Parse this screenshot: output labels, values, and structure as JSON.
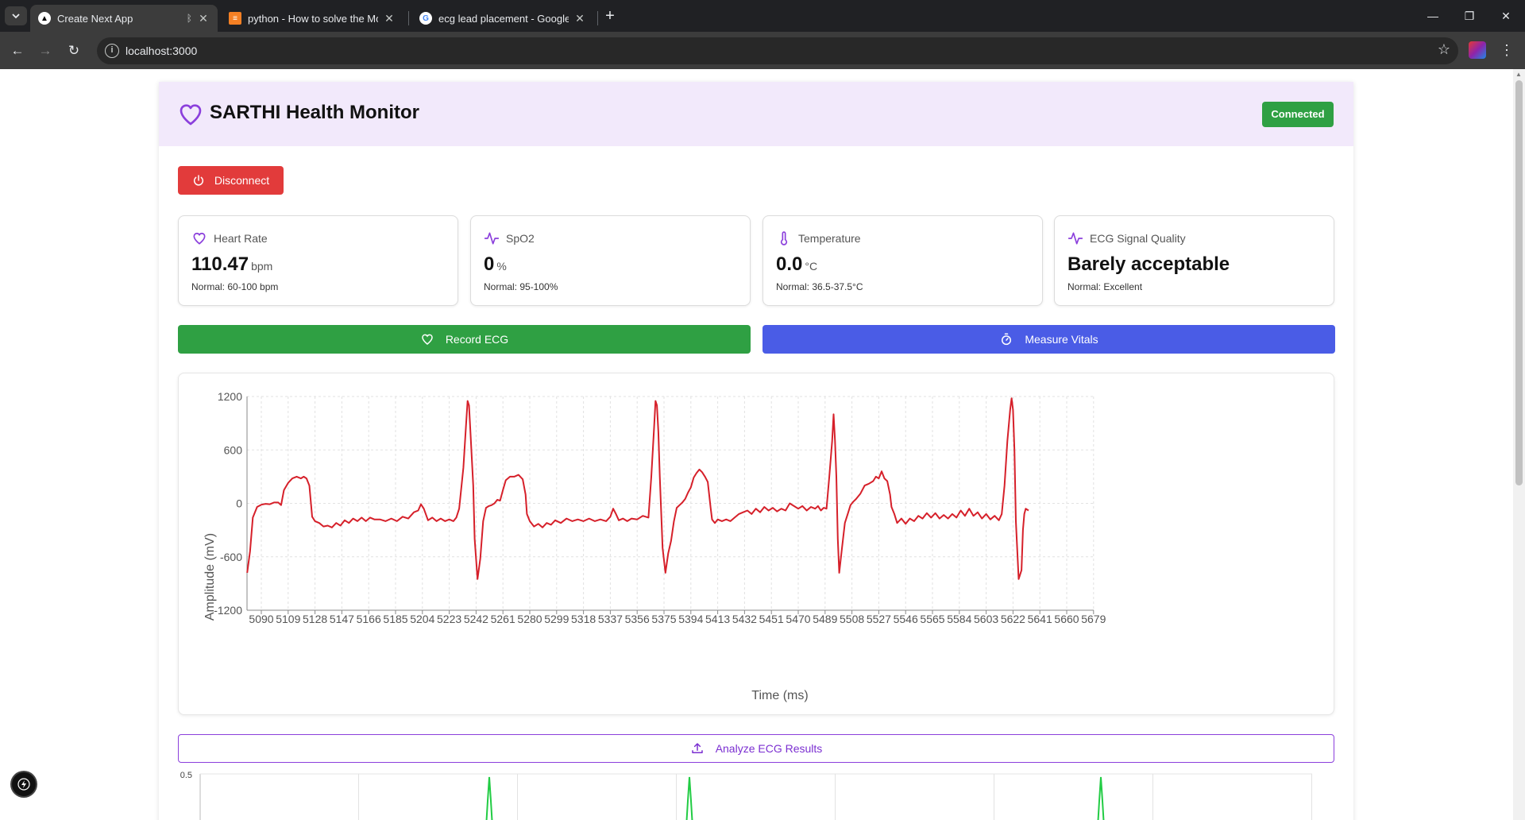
{
  "browser": {
    "tabs": [
      {
        "title": "Create Next App",
        "active": true
      },
      {
        "title": "python - How to solve the Mod",
        "active": false
      },
      {
        "title": "ecg lead placement - Google Se",
        "active": false
      }
    ],
    "url": "localhost:3000"
  },
  "header": {
    "title": "SARTHI Health Monitor",
    "status_badge": "Connected"
  },
  "controls": {
    "disconnect_label": "Disconnect",
    "record_label": "Record ECG",
    "measure_label": "Measure Vitals",
    "analyze_label": "Analyze ECG Results"
  },
  "stats": {
    "heart_rate": {
      "label": "Heart Rate",
      "value": "110.47",
      "unit": "bpm",
      "normal": "Normal: 60-100 bpm"
    },
    "spo2": {
      "label": "SpO2",
      "value": "0",
      "unit": "%",
      "normal": "Normal: 95-100%"
    },
    "temperature": {
      "label": "Temperature",
      "value": "0.0",
      "unit": "°C",
      "normal": "Normal: 36.5-37.5°C"
    },
    "ecg_quality": {
      "label": "ECG Signal Quality",
      "value": "Barely acceptable",
      "normal": "Normal: Excellent"
    }
  },
  "colors": {
    "accent_purple": "#8b3fdc",
    "success_green": "#2fa043",
    "danger_red": "#e23b3b",
    "primary_blue": "#4a5ce6",
    "ecg_line": "#d6202a",
    "secondary_line": "#22cc44"
  },
  "chart_data": [
    {
      "type": "line",
      "title": "",
      "xlabel": "Time (ms)",
      "ylabel": "Amplitude (mV)",
      "ylim": [
        -1200,
        1200
      ],
      "yticks": [
        1200,
        600,
        0,
        -600,
        -1200
      ],
      "xtick_labels": [
        "5090",
        "5109",
        "5128",
        "5147",
        "5166",
        "5185",
        "5204",
        "5223",
        "5242",
        "5261",
        "5280",
        "5299",
        "5318",
        "5337",
        "5356",
        "5375",
        "5394",
        "5413",
        "5432",
        "5451",
        "5470",
        "5489",
        "5508",
        "5527",
        "5546",
        "5565",
        "5584",
        "5603",
        "5622",
        "5641",
        "5660",
        "5679"
      ],
      "grid": true,
      "series": [
        {
          "color": "#d6202a",
          "points": [
            [
              5080,
              -780
            ],
            [
              5082,
              -540
            ],
            [
              5084,
              -160
            ],
            [
              5087,
              -40
            ],
            [
              5090,
              -15
            ],
            [
              5093,
              -5
            ],
            [
              5096,
              -10
            ],
            [
              5099,
              10
            ],
            [
              5102,
              10
            ],
            [
              5104,
              -20
            ],
            [
              5106,
              150
            ],
            [
              5109,
              230
            ],
            [
              5112,
              280
            ],
            [
              5115,
              300
            ],
            [
              5118,
              280
            ],
            [
              5120,
              300
            ],
            [
              5122,
              280
            ],
            [
              5124,
              200
            ],
            [
              5126,
              -150
            ],
            [
              5128,
              -200
            ],
            [
              5131,
              -220
            ],
            [
              5134,
              -260
            ],
            [
              5137,
              -250
            ],
            [
              5140,
              -270
            ],
            [
              5143,
              -220
            ],
            [
              5146,
              -250
            ],
            [
              5149,
              -190
            ],
            [
              5152,
              -220
            ],
            [
              5155,
              -170
            ],
            [
              5158,
              -200
            ],
            [
              5161,
              -160
            ],
            [
              5164,
              -200
            ],
            [
              5167,
              -160
            ],
            [
              5170,
              -180
            ],
            [
              5174,
              -180
            ],
            [
              5178,
              -200
            ],
            [
              5182,
              -170
            ],
            [
              5186,
              -200
            ],
            [
              5190,
              -150
            ],
            [
              5194,
              -170
            ],
            [
              5198,
              -100
            ],
            [
              5201,
              -80
            ],
            [
              5203,
              -10
            ],
            [
              5205,
              -60
            ],
            [
              5208,
              -190
            ],
            [
              5211,
              -160
            ],
            [
              5214,
              -200
            ],
            [
              5217,
              -170
            ],
            [
              5220,
              -200
            ],
            [
              5223,
              -180
            ],
            [
              5226,
              -200
            ],
            [
              5228,
              -160
            ],
            [
              5230,
              -60
            ],
            [
              5233,
              400
            ],
            [
              5235,
              900
            ],
            [
              5236,
              1150
            ],
            [
              5237,
              1100
            ],
            [
              5238,
              800
            ],
            [
              5240,
              200
            ],
            [
              5241,
              -400
            ],
            [
              5243,
              -850
            ],
            [
              5245,
              -620
            ],
            [
              5247,
              -200
            ],
            [
              5249,
              -50
            ],
            [
              5251,
              -30
            ],
            [
              5253,
              -20
            ],
            [
              5255,
              0
            ],
            [
              5257,
              40
            ],
            [
              5259,
              30
            ],
            [
              5261,
              150
            ],
            [
              5263,
              260
            ],
            [
              5266,
              300
            ],
            [
              5269,
              300
            ],
            [
              5272,
              320
            ],
            [
              5275,
              270
            ],
            [
              5277,
              100
            ],
            [
              5278,
              -120
            ],
            [
              5280,
              -200
            ],
            [
              5283,
              -260
            ],
            [
              5286,
              -230
            ],
            [
              5289,
              -270
            ],
            [
              5292,
              -220
            ],
            [
              5295,
              -240
            ],
            [
              5298,
              -190
            ],
            [
              5302,
              -220
            ],
            [
              5306,
              -170
            ],
            [
              5310,
              -200
            ],
            [
              5314,
              -180
            ],
            [
              5318,
              -200
            ],
            [
              5322,
              -170
            ],
            [
              5326,
              -200
            ],
            [
              5330,
              -180
            ],
            [
              5334,
              -200
            ],
            [
              5337,
              -150
            ],
            [
              5339,
              -60
            ],
            [
              5341,
              -120
            ],
            [
              5343,
              -190
            ],
            [
              5346,
              -170
            ],
            [
              5349,
              -200
            ],
            [
              5352,
              -170
            ],
            [
              5356,
              -180
            ],
            [
              5360,
              -140
            ],
            [
              5364,
              -160
            ],
            [
              5366,
              300
            ],
            [
              5368,
              850
            ],
            [
              5369,
              1150
            ],
            [
              5370,
              1100
            ],
            [
              5371,
              800
            ],
            [
              5372,
              300
            ],
            [
              5374,
              -500
            ],
            [
              5376,
              -780
            ],
            [
              5378,
              -560
            ],
            [
              5380,
              -420
            ],
            [
              5382,
              -200
            ],
            [
              5384,
              -50
            ],
            [
              5386,
              -20
            ],
            [
              5388,
              10
            ],
            [
              5390,
              50
            ],
            [
              5392,
              120
            ],
            [
              5394,
              180
            ],
            [
              5396,
              290
            ],
            [
              5398,
              340
            ],
            [
              5400,
              380
            ],
            [
              5402,
              350
            ],
            [
              5404,
              300
            ],
            [
              5406,
              240
            ],
            [
              5408,
              -50
            ],
            [
              5409,
              -180
            ],
            [
              5411,
              -220
            ],
            [
              5413,
              -180
            ],
            [
              5416,
              -200
            ],
            [
              5419,
              -180
            ],
            [
              5422,
              -200
            ],
            [
              5425,
              -160
            ],
            [
              5428,
              -120
            ],
            [
              5431,
              -100
            ],
            [
              5434,
              -80
            ],
            [
              5437,
              -120
            ],
            [
              5440,
              -60
            ],
            [
              5443,
              -100
            ],
            [
              5446,
              -40
            ],
            [
              5449,
              -80
            ],
            [
              5452,
              -50
            ],
            [
              5455,
              -90
            ],
            [
              5458,
              -60
            ],
            [
              5461,
              -80
            ],
            [
              5464,
              0
            ],
            [
              5467,
              -30
            ],
            [
              5470,
              -60
            ],
            [
              5473,
              -30
            ],
            [
              5476,
              -80
            ],
            [
              5479,
              -40
            ],
            [
              5482,
              -60
            ],
            [
              5484,
              -30
            ],
            [
              5486,
              -80
            ],
            [
              5488,
              -50
            ],
            [
              5490,
              -60
            ],
            [
              5492,
              300
            ],
            [
              5494,
              700
            ],
            [
              5495,
              1000
            ],
            [
              5496,
              700
            ],
            [
              5497,
              300
            ],
            [
              5498,
              -400
            ],
            [
              5499,
              -780
            ],
            [
              5501,
              -500
            ],
            [
              5503,
              -220
            ],
            [
              5505,
              -120
            ],
            [
              5507,
              -20
            ],
            [
              5509,
              20
            ],
            [
              5511,
              50
            ],
            [
              5514,
              110
            ],
            [
              5517,
              200
            ],
            [
              5520,
              220
            ],
            [
              5523,
              250
            ],
            [
              5525,
              300
            ],
            [
              5527,
              280
            ],
            [
              5529,
              360
            ],
            [
              5531,
              280
            ],
            [
              5533,
              250
            ],
            [
              5535,
              100
            ],
            [
              5536,
              -40
            ],
            [
              5538,
              -120
            ],
            [
              5540,
              -220
            ],
            [
              5543,
              -170
            ],
            [
              5546,
              -230
            ],
            [
              5549,
              -170
            ],
            [
              5552,
              -200
            ],
            [
              5555,
              -140
            ],
            [
              5558,
              -170
            ],
            [
              5561,
              -110
            ],
            [
              5564,
              -160
            ],
            [
              5567,
              -110
            ],
            [
              5570,
              -170
            ],
            [
              5573,
              -130
            ],
            [
              5576,
              -170
            ],
            [
              5579,
              -120
            ],
            [
              5582,
              -160
            ],
            [
              5585,
              -80
            ],
            [
              5588,
              -140
            ],
            [
              5591,
              -60
            ],
            [
              5594,
              -140
            ],
            [
              5597,
              -100
            ],
            [
              5600,
              -170
            ],
            [
              5603,
              -120
            ],
            [
              5606,
              -180
            ],
            [
              5609,
              -140
            ],
            [
              5612,
              -190
            ],
            [
              5614,
              -120
            ],
            [
              5616,
              200
            ],
            [
              5618,
              700
            ],
            [
              5620,
              1050
            ],
            [
              5621,
              1180
            ],
            [
              5622,
              1050
            ],
            [
              5623,
              600
            ],
            [
              5624,
              -200
            ],
            [
              5626,
              -850
            ],
            [
              5628,
              -750
            ],
            [
              5629,
              -300
            ],
            [
              5630,
              -120
            ],
            [
              5631,
              -60
            ],
            [
              5633,
              -80
            ]
          ]
        }
      ]
    },
    {
      "type": "line",
      "title": "",
      "yticks": [
        0.5
      ],
      "series": [
        {
          "color": "#22cc44",
          "peaks_at_fraction": [
            0.26,
            0.44,
            0.81
          ]
        }
      ]
    }
  ]
}
